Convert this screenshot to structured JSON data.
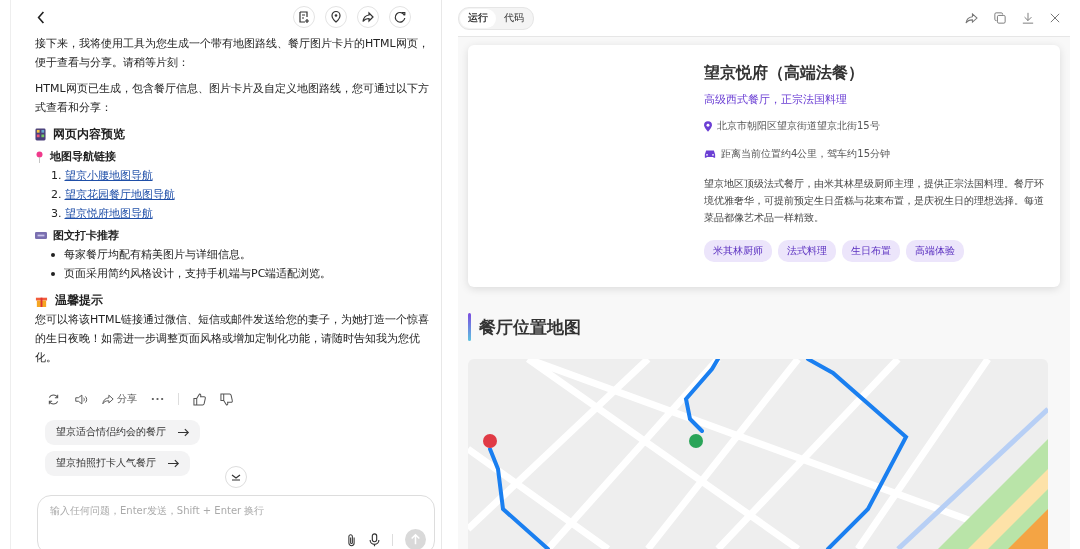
{
  "chat": {
    "blocks": [
      {
        "kind": "paragraph",
        "text": "接下来，我将使用工具为您生成一个带有地图路线、餐厅图片卡片的HTML网页，便于查看与分享。请稍等片刻："
      },
      {
        "kind": "paragraph",
        "text": "HTML网页已生成，包含餐厅信息、图片卡片及自定义地图路线，您可通过以下方式查看和分享："
      },
      {
        "kind": "heading",
        "text": "网页内容预览"
      },
      {
        "kind": "subheading",
        "text": "地图导航链接"
      },
      {
        "kind": "links",
        "items": [
          {
            "marker": "1.",
            "text": "望京小腰地图导航"
          },
          {
            "marker": "2.",
            "text": "望京花园餐厅地图导航"
          },
          {
            "marker": "3.",
            "text": "望京悦府地图导航"
          }
        ]
      },
      {
        "kind": "subheading",
        "text": "图文打卡推荐"
      },
      {
        "kind": "bullets",
        "items": [
          "每家餐厅均配有精美图片与详细信息。",
          "页面采用简约风格设计，支持手机端与PC端适配浏览。"
        ]
      },
      {
        "kind": "heading",
        "text": "温馨提示"
      },
      {
        "kind": "paragraph",
        "text": "您可以将该HTML链接通过微信、短信或邮件发送给您的妻子，为她打造一个惊喜的生日夜晚！如需进一步调整页面风格或增加定制化功能，请随时告知我为您优化。"
      }
    ],
    "share_label": "分享",
    "suggestions": [
      "望京适合情侣约会的餐厅",
      "望京拍照打卡人气餐厅"
    ],
    "input": {
      "placeholder": "输入任何问题，Enter发送，Shift + Enter 换行"
    }
  },
  "preview": {
    "tabs": [
      {
        "label": "运行",
        "selected": true
      },
      {
        "label": "代码",
        "selected": false
      }
    ],
    "restaurant": {
      "name": "望京悦府（高端法餐）",
      "subtitle": "高级西式餐厅，正宗法国料理",
      "address": "北京市朝阳区望京街道望京北街15号",
      "distance": "距离当前位置约4公里，驾车约15分钟",
      "description": "望京地区顶级法式餐厅，由米其林星级厨师主理，提供正宗法国料理。餐厅环境优雅奢华，可提前预定生日蛋糕与花束布置，是庆祝生日的理想选择。每道菜品都像艺术品一样精致。",
      "tags": [
        "米其林厨师",
        "法式料理",
        "生日布置",
        "高端体验"
      ]
    },
    "map_section": {
      "title": "餐厅位置地图"
    }
  }
}
